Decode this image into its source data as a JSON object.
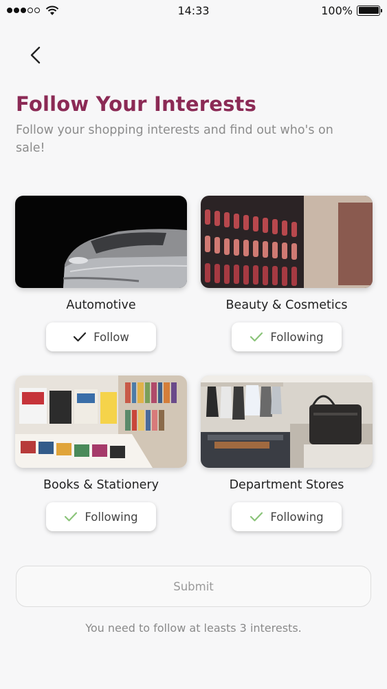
{
  "status_bar": {
    "time": "14:33",
    "battery": "100%",
    "signal_icon": "signal-dots-icon",
    "wifi_icon": "wifi-icon",
    "battery_icon": "battery-icon"
  },
  "nav": {
    "back_icon": "chevron-left-icon"
  },
  "header": {
    "title": "Follow Your Interests",
    "subtitle": "Follow your shopping interests and find out who's on sale!"
  },
  "interests": [
    {
      "label": "Automotive",
      "button": "Follow",
      "checkmark_color": "#222222"
    },
    {
      "label": "Beauty & Cosmetics",
      "button": "Following",
      "checkmark_color": "#8bc47a"
    },
    {
      "label": "Books & Stationery",
      "button": "Following",
      "checkmark_color": "#8bc47a"
    },
    {
      "label": "Department Stores",
      "button": "Following",
      "checkmark_color": "#8bc47a"
    }
  ],
  "submit": {
    "label": "Submit"
  },
  "hint": "You need to follow at leasts 3 interests.",
  "colors": {
    "title": "#8b2a55",
    "check_active": "#8bc47a",
    "background": "#f7f7f8"
  }
}
